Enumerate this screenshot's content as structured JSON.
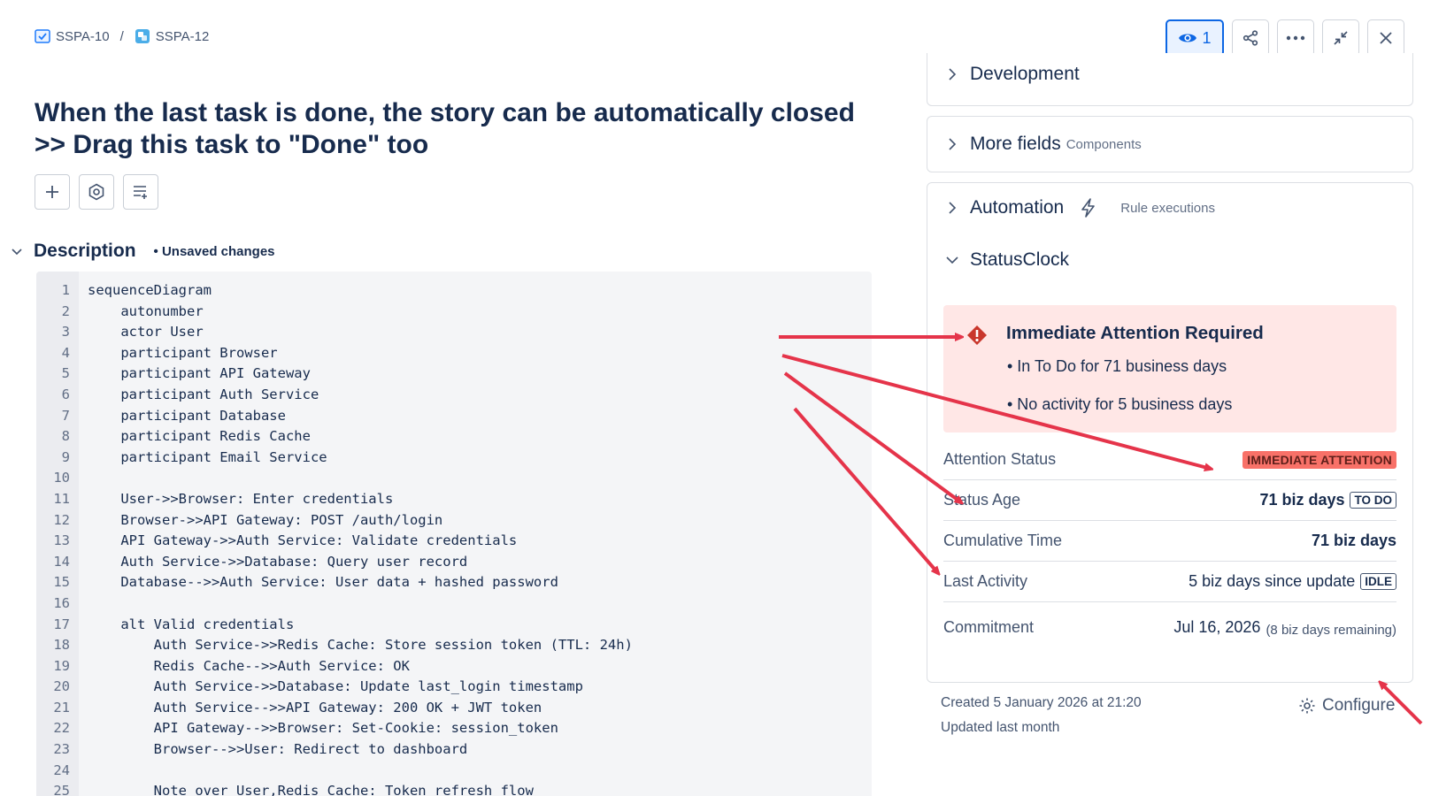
{
  "breadcrumb": {
    "parent": "SSPA-10",
    "separator": "/",
    "current": "SSPA-12"
  },
  "toolbar": {
    "watch_count": "1"
  },
  "issue": {
    "title": "When the last task is done, the story can be automatically closed >> Drag this task to \"Done\" too"
  },
  "description": {
    "heading": "Description",
    "unsaved": "• Unsaved changes",
    "lines": [
      {
        "n": "1",
        "text": "sequenceDiagram"
      },
      {
        "n": "2",
        "text": "    autonumber"
      },
      {
        "n": "3",
        "text": "    actor User"
      },
      {
        "n": "4",
        "text": "    participant Browser"
      },
      {
        "n": "5",
        "text": "    participant API Gateway"
      },
      {
        "n": "6",
        "text": "    participant Auth Service"
      },
      {
        "n": "7",
        "text": "    participant Database"
      },
      {
        "n": "8",
        "text": "    participant Redis Cache"
      },
      {
        "n": "9",
        "text": "    participant Email Service"
      },
      {
        "n": "10",
        "text": ""
      },
      {
        "n": "11",
        "text": "    User->>Browser: Enter credentials"
      },
      {
        "n": "12",
        "text": "    Browser->>API Gateway: POST /auth/login"
      },
      {
        "n": "13",
        "text": "    API Gateway->>Auth Service: Validate credentials"
      },
      {
        "n": "14",
        "text": "    Auth Service->>Database: Query user record"
      },
      {
        "n": "15",
        "text": "    Database-->>Auth Service: User data + hashed password"
      },
      {
        "n": "16",
        "text": ""
      },
      {
        "n": "17",
        "text": "    alt Valid credentials"
      },
      {
        "n": "18",
        "text": "        Auth Service->>Redis Cache: Store session token (TTL: 24h)"
      },
      {
        "n": "19",
        "text": "        Redis Cache-->>Auth Service: OK"
      },
      {
        "n": "20",
        "text": "        Auth Service->>Database: Update last_login timestamp"
      },
      {
        "n": "21",
        "text": "        Auth Service-->>API Gateway: 200 OK + JWT token"
      },
      {
        "n": "22",
        "text": "        API Gateway-->>Browser: Set-Cookie: session_token"
      },
      {
        "n": "23",
        "text": "        Browser-->>User: Redirect to dashboard"
      },
      {
        "n": "24",
        "text": ""
      },
      {
        "n": "25",
        "text": "        Note over User,Redis Cache: Token refresh flow"
      }
    ]
  },
  "sidebar": {
    "development": "Development",
    "more_fields": "More fields",
    "more_fields_sub": "Components",
    "automation": "Automation",
    "automation_sub": "Rule executions",
    "statusclock": "StatusClock",
    "alert": {
      "title": "Immediate Attention Required",
      "bullet1": "• In To Do for 71 business days",
      "bullet2": "• No activity for 5 business days"
    },
    "rows": {
      "attention_label": "Attention Status",
      "attention_badge": "IMMEDIATE ATTENTION",
      "age_label": "Status Age",
      "age_value": "71 biz days",
      "age_badge": "TO DO",
      "cumulative_label": "Cumulative Time",
      "cumulative_value": "71 biz days",
      "activity_label": "Last Activity",
      "activity_value": "5 biz days since update",
      "activity_badge": "IDLE",
      "commitment_label": "Commitment",
      "commitment_date": "Jul 16, 2026",
      "commitment_remaining": "(8 biz days remaining)"
    },
    "created": "Created 5 January 2026 at 21:20",
    "updated": "Updated last month",
    "configure": "Configure"
  },
  "colors": {
    "accent": "#0c66e4",
    "alert_bg": "#ffe7e6",
    "arrow": "#e5344a",
    "badge_red": "#f87168"
  }
}
